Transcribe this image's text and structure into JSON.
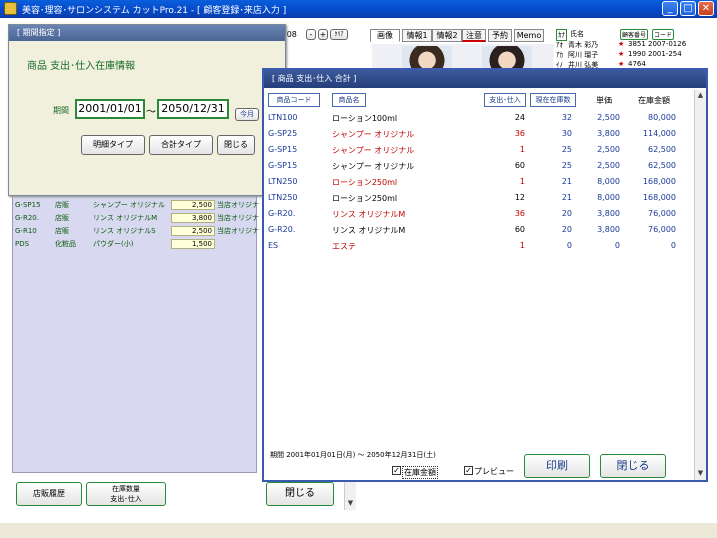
{
  "window": {
    "title": "美容･理容･サロンシステム カットPro.21 - [ 顧客登録･来店入力 ]",
    "min_label": "_",
    "max_label": "□",
    "close_label": "✕"
  },
  "customer_panel": {
    "date_fragment": "/08",
    "minus_label": "-",
    "plus_label": "+",
    "clear_label": "ｸﾘｱ",
    "tabs": [
      "画像",
      "情報1",
      "情報2",
      "注意",
      "予約",
      "Memo"
    ],
    "kana_label": "ｶﾅ",
    "name_label": "氏名",
    "badge1": "顧客番号",
    "badge2": "コード",
    "list": [
      {
        "kana": "ｱｵ",
        "name": "青木 彩乃",
        "mark": "★",
        "no": "3851",
        "code": "2007-0126"
      },
      {
        "kana": "ｱｶ",
        "name": "阿川 瑠子",
        "mark": "★",
        "no": "1990",
        "code": "2001-254"
      },
      {
        "kana": "ｲﾉ",
        "name": "井川 弘美",
        "mark": "★",
        "no": "4764",
        "code": ""
      }
    ]
  },
  "background_list": {
    "rows": [
      {
        "code": "G-SP15",
        "type": "店販",
        "name": "シャンプー オリジナル",
        "amount": "2,500",
        "shop": "当店オリジナ"
      },
      {
        "code": "G-R20.",
        "type": "店販",
        "name": "リンス オリジナルM",
        "amount": "3,800",
        "shop": "当店オリジナ"
      },
      {
        "code": "G-R10",
        "type": "店販",
        "name": "リンス オリジナルS",
        "amount": "2,500",
        "shop": "当店オリジナ"
      },
      {
        "code": "PDS",
        "type": "化粧品",
        "name": "パウダー(小)",
        "amount": "1,500",
        "shop": ""
      }
    ],
    "history_button": "店販履歴",
    "stock_button_line1": "在庫数量",
    "stock_button_line2": "支出･仕入",
    "close_button": "閉じる"
  },
  "period_dialog": {
    "title": "[ 期間指定 ]",
    "heading": "商品 支出･仕入在庫情報",
    "period_label": "期間",
    "start_date": "2001/01/01",
    "tilde": "～",
    "end_date": "2050/12/31",
    "this_month": "今月",
    "detail_button": "明細タイプ",
    "total_button": "合計タイプ",
    "close_button": "閉じる"
  },
  "summary_dialog": {
    "title": "[ 商品 支出･仕入 合計 ]",
    "columns": {
      "code": "商品コード",
      "name": "商品名",
      "qty": "支出･仕入",
      "stock": "現在在庫数",
      "price": "単価",
      "total": "在庫金額"
    },
    "rows": [
      {
        "code": "LTN100",
        "name": "ローション100ml",
        "qty": "24",
        "stock": "32",
        "price": "2,500",
        "total": "80,000",
        "red": false
      },
      {
        "code": "G-SP25",
        "name": "シャンプー オリジナル",
        "qty": "36",
        "stock": "30",
        "price": "3,800",
        "total": "114,000",
        "red": true
      },
      {
        "code": "G-SP15",
        "name": "シャンプー オリジナル",
        "qty": "1",
        "stock": "25",
        "price": "2,500",
        "total": "62,500",
        "red": true
      },
      {
        "code": "G-SP15",
        "name": "シャンプー オリジナル",
        "qty": "60",
        "stock": "25",
        "price": "2,500",
        "total": "62,500",
        "red": false
      },
      {
        "code": "LTN250",
        "name": "ローション250ml",
        "qty": "1",
        "stock": "21",
        "price": "8,000",
        "total": "168,000",
        "red": true
      },
      {
        "code": "LTN250",
        "name": "ローション250ml",
        "qty": "12",
        "stock": "21",
        "price": "8,000",
        "total": "168,000",
        "red": false
      },
      {
        "code": "G-R20.",
        "name": "リンス オリジナルM",
        "qty": "36",
        "stock": "20",
        "price": "3,800",
        "total": "76,000",
        "red": true
      },
      {
        "code": "G-R20.",
        "name": "リンス オリジナルM",
        "qty": "60",
        "stock": "20",
        "price": "3,800",
        "total": "76,000",
        "red": false
      },
      {
        "code": "ES",
        "name": "エステ",
        "qty": "1",
        "stock": "0",
        "price": "0",
        "total": "0",
        "red": true
      }
    ],
    "period_text": "期間  2001年01月01日(月) ～  2050年12月31日(土)",
    "stock_amount_label": "在庫金額",
    "preview_label": "プレビュー",
    "print_button": "印刷",
    "close_button": "閉じる"
  },
  "colors": {
    "title_bar": "#0548c8",
    "dialog_header": "#3c5a9c",
    "code_blue": "#1a3a9a",
    "red_text": "#c00000",
    "green_button": "#2a8a3a"
  }
}
